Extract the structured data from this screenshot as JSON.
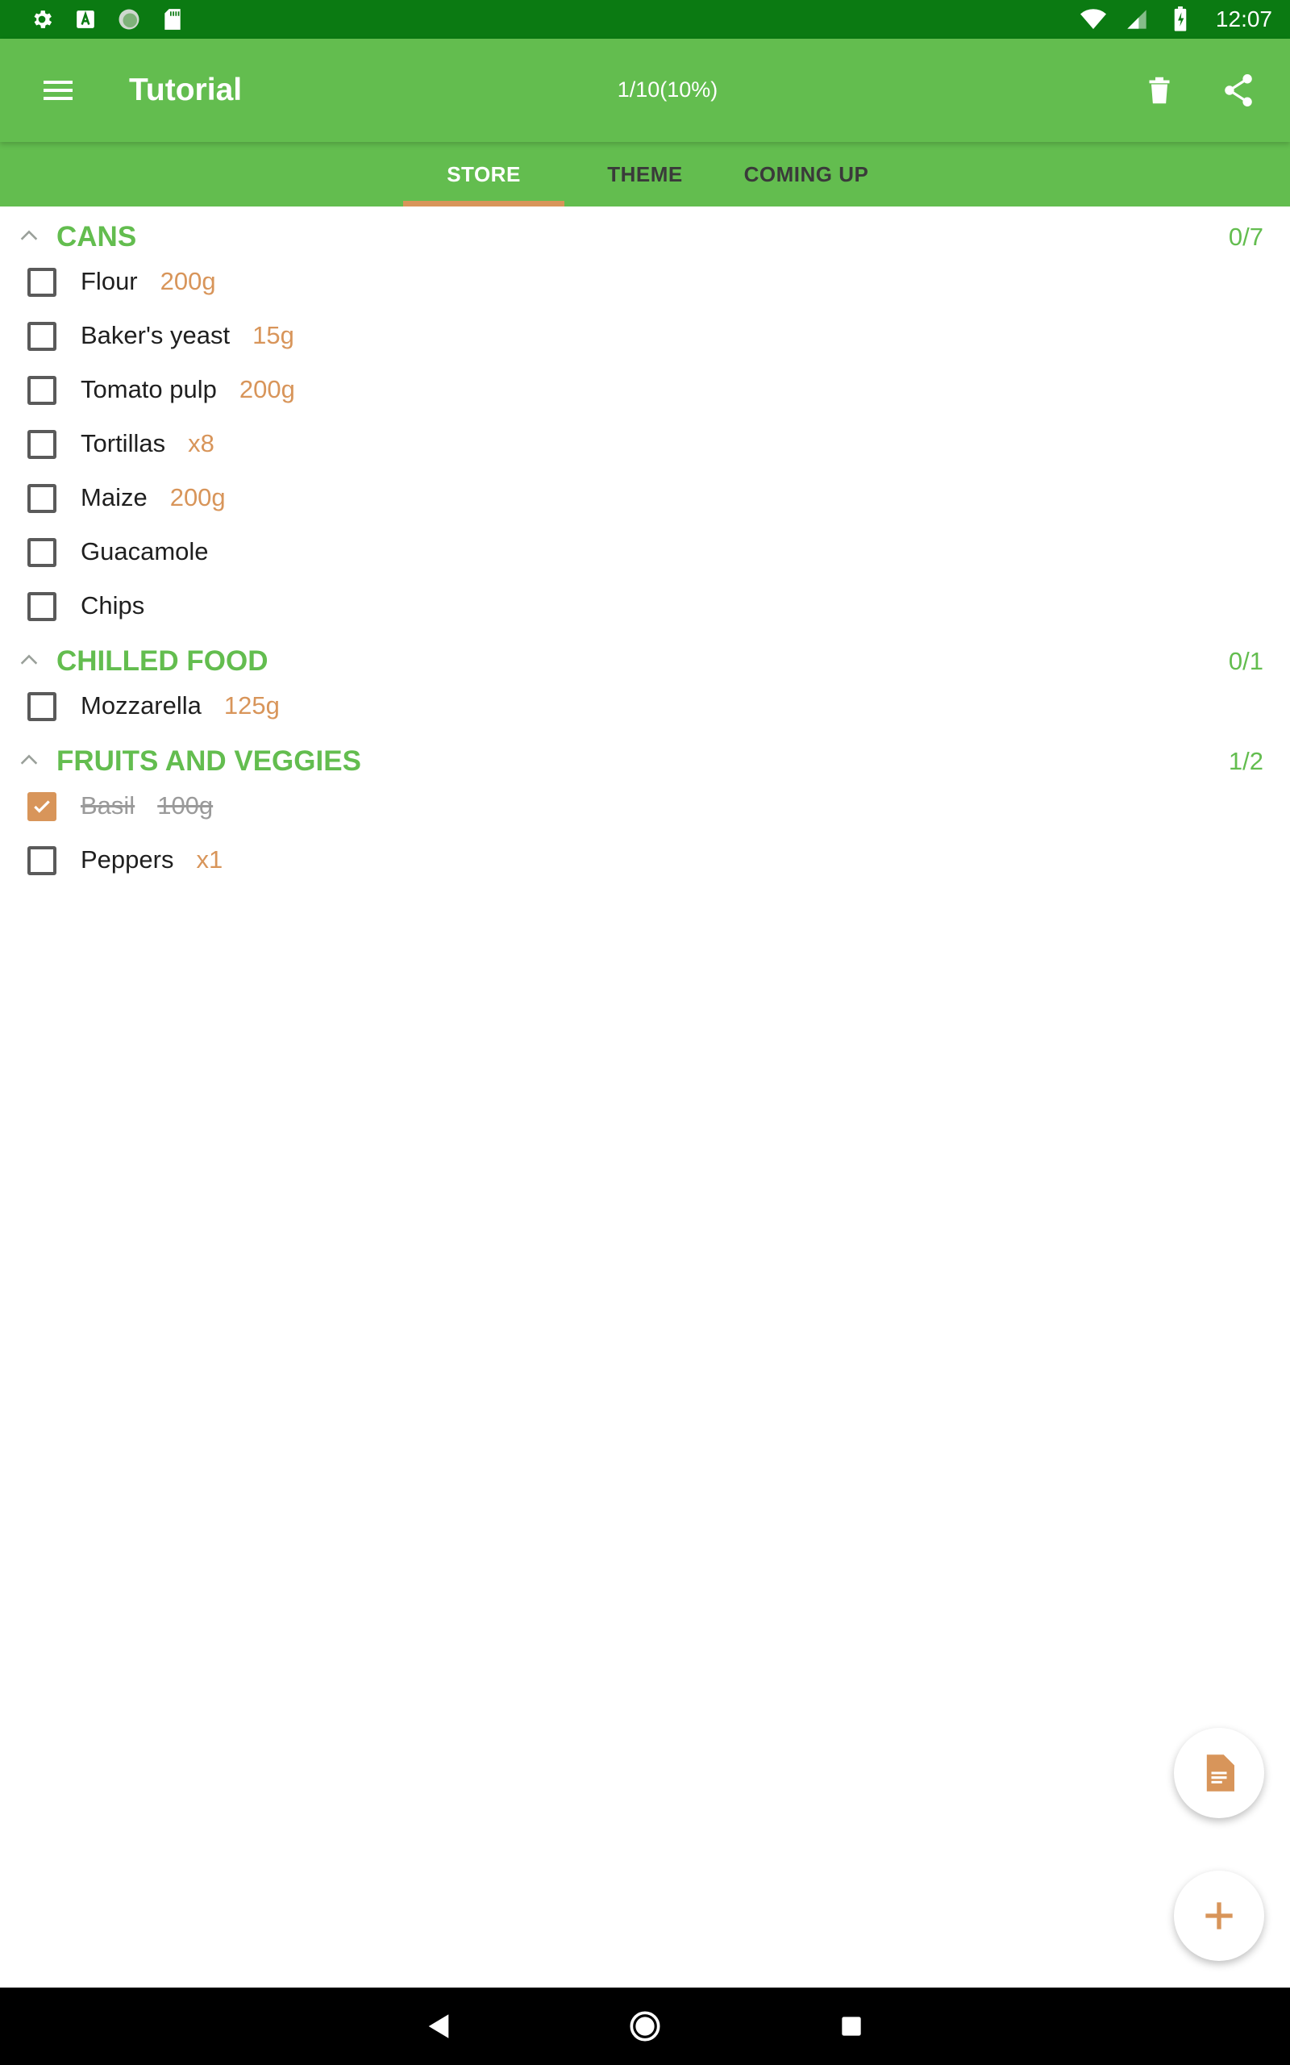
{
  "status_bar": {
    "time": "12:07"
  },
  "app_bar": {
    "title": "Tutorial",
    "progress": "1/10(10%)"
  },
  "tabs": [
    {
      "label": "STORE",
      "active": true
    },
    {
      "label": "THEME",
      "active": false
    },
    {
      "label": "COMING UP",
      "active": false
    }
  ],
  "sections": [
    {
      "title": "CANS",
      "count": "0/7",
      "items": [
        {
          "name": "Flour",
          "qty": "200g",
          "checked": false
        },
        {
          "name": "Baker's yeast",
          "qty": "15g",
          "checked": false
        },
        {
          "name": "Tomato pulp",
          "qty": "200g",
          "checked": false
        },
        {
          "name": "Tortillas",
          "qty": "x8",
          "checked": false
        },
        {
          "name": "Maize",
          "qty": "200g",
          "checked": false
        },
        {
          "name": "Guacamole",
          "qty": "",
          "checked": false
        },
        {
          "name": "Chips",
          "qty": "",
          "checked": false
        }
      ]
    },
    {
      "title": "CHILLED FOOD",
      "count": "0/1",
      "items": [
        {
          "name": "Mozzarella",
          "qty": "125g",
          "checked": false
        }
      ]
    },
    {
      "title": "FRUITS AND VEGGIES",
      "count": "1/2",
      "items": [
        {
          "name": "Basil",
          "qty": "100g",
          "checked": true
        },
        {
          "name": "Peppers",
          "qty": "x1",
          "checked": false
        }
      ]
    }
  ],
  "colors": {
    "primary": "#63bd4f",
    "status_bar": "#0b7a12",
    "accent": "#d8955a"
  },
  "icons": [
    "settings-icon",
    "a-box-icon",
    "circle-app-icon",
    "sd-card-icon",
    "wifi-icon",
    "signal-icon",
    "battery-charging-icon",
    "menu-icon",
    "trash-icon",
    "share-icon",
    "chevron-up-icon",
    "document-icon",
    "plus-icon",
    "back-icon",
    "home-icon",
    "recents-icon"
  ]
}
